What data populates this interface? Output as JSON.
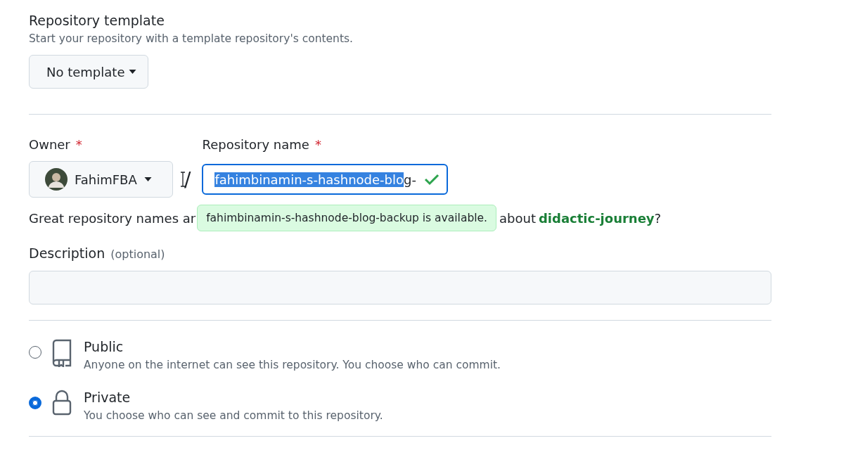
{
  "template": {
    "title": "Repository template",
    "description": "Start your repository with a template repository's contents.",
    "button": "No template"
  },
  "owner": {
    "label": "Owner",
    "required_mark": "*",
    "value": "FahimFBA"
  },
  "separator": "/",
  "repo_name": {
    "label": "Repository name",
    "required_mark": "*",
    "value_selected": "fahimbinamin-s-hashnode-blo",
    "value_rest": "g-",
    "valid": true
  },
  "tooltip": "fahimbinamin-s-hashnode-blog-backup is available.",
  "helper": {
    "before": "Great repository names ar",
    "after": "about",
    "link": "didactic-journey",
    "end": "?"
  },
  "description": {
    "label": "Description",
    "optional": "(optional)"
  },
  "visibility": [
    {
      "kind": "public",
      "title": "Public",
      "text": "Anyone on the internet can see this repository. You choose who can commit.",
      "selected": false
    },
    {
      "kind": "private",
      "title": "Private",
      "text": "You choose who can see and commit to this repository.",
      "selected": true
    }
  ]
}
